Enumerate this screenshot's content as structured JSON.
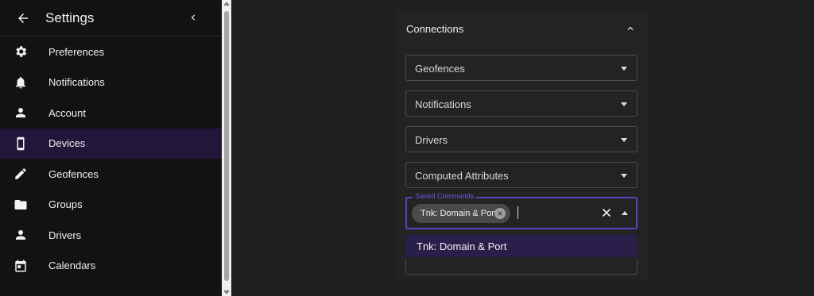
{
  "sidebar": {
    "title": "Settings",
    "back_icon": "arrow-left-icon",
    "collapse_icon": "chevron-left-icon",
    "items": [
      {
        "label": "Preferences",
        "icon": "gear-icon"
      },
      {
        "label": "Notifications",
        "icon": "bell-icon"
      },
      {
        "label": "Account",
        "icon": "person-icon"
      },
      {
        "label": "Devices",
        "icon": "smartphone-icon",
        "active": true
      },
      {
        "label": "Geofences",
        "icon": "pencil-icon"
      },
      {
        "label": "Groups",
        "icon": "folder-icon"
      },
      {
        "label": "Drivers",
        "icon": "person-icon"
      },
      {
        "label": "Calendars",
        "icon": "calendar-icon"
      }
    ]
  },
  "panel": {
    "title": "Connections",
    "fields": [
      {
        "value": "Geofences"
      },
      {
        "value": "Notifications"
      },
      {
        "value": "Drivers"
      },
      {
        "value": "Computed Attributes"
      }
    ],
    "saved_commands": {
      "label": "Saved Commands",
      "chips": [
        "Tnk: Domain & Port"
      ]
    },
    "dropdown_options": [
      "Tnk: Domain & Port"
    ]
  },
  "colors": {
    "accent": "#5b3fc4",
    "active_item_bg": "#22173a",
    "option_bg": "#2a1f4a"
  }
}
